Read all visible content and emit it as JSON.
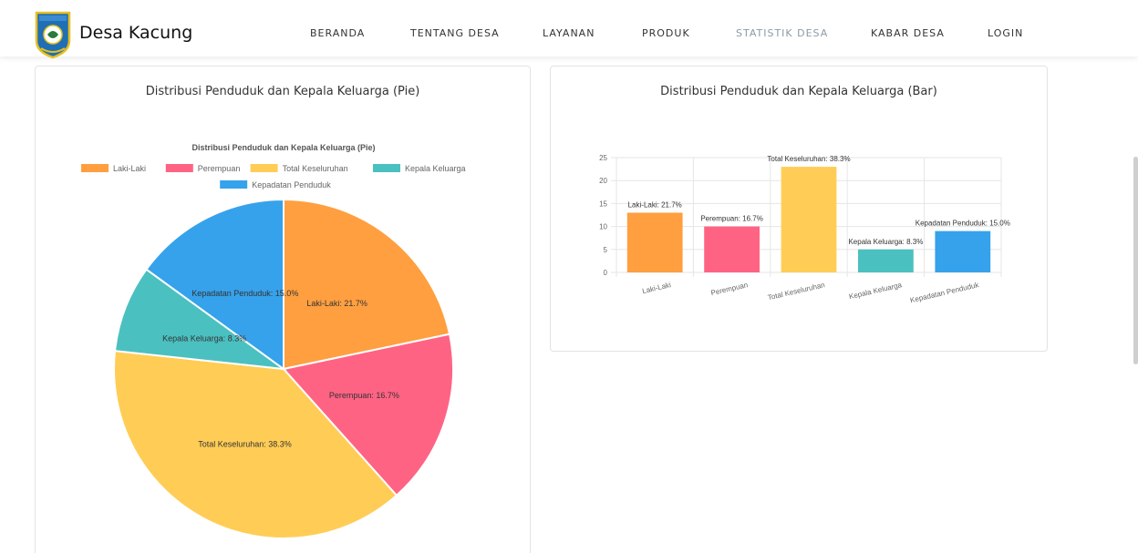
{
  "nav": {
    "brand": "Desa Kacung",
    "items": [
      {
        "label": "BERANDA"
      },
      {
        "label": "TENTANG DESA"
      },
      {
        "label": "LAYANAN"
      },
      {
        "label": "PRODUK"
      },
      {
        "label": "STATISTIK DESA"
      },
      {
        "label": "KABAR DESA"
      },
      {
        "label": "LOGIN"
      }
    ],
    "active_index": 4
  },
  "pie_card": {
    "heading": "Distribusi Penduduk dan Kepala Keluarga (Pie)"
  },
  "bar_card": {
    "heading": "Distribusi Penduduk dan Kepala Keluarga (Bar)"
  },
  "colors": {
    "laki": "#FF9F40",
    "perempuan": "#FF6384",
    "total": "#FFCD56",
    "kk": "#4BC0C0",
    "kepadatan": "#36A2EB",
    "active_nav": "#8c9aa6"
  },
  "chart_data": [
    {
      "type": "pie",
      "title": "Distribusi Penduduk dan Kepala Keluarga (Pie)",
      "categories": [
        "Laki-Laki",
        "Perempuan",
        "Total Keseluruhan",
        "Kepala Keluarga",
        "Kepadatan Penduduk"
      ],
      "values": [
        21.7,
        16.7,
        38.3,
        8.3,
        15.0
      ],
      "labels": [
        "Laki-Laki: 21.7%",
        "Perempuan: 16.7%",
        "Total Keseluruhan: 38.3%",
        "Kepala Keluarga: 8.3%",
        "Kepadatan Penduduk: 15.0%"
      ],
      "colors": [
        "#FF9F40",
        "#FF6384",
        "#FFCD56",
        "#4BC0C0",
        "#36A2EB"
      ],
      "legend": "top"
    },
    {
      "type": "bar",
      "categories": [
        "Laki-Laki",
        "Perempuan",
        "Total Keseluruhan",
        "Kepala Keluarga",
        "Kepadatan Penduduk"
      ],
      "values": [
        13,
        10,
        23,
        5,
        9
      ],
      "labels": [
        "Laki-Laki: 21.7%",
        "Perempuan: 16.7%",
        "Total Keseluruhan: 38.3%",
        "Kepala Keluarga: 8.3%",
        "Kepadatan Penduduk: 15.0%"
      ],
      "colors": [
        "#FF9F40",
        "#FF6384",
        "#FFCD56",
        "#4BC0C0",
        "#36A2EB"
      ],
      "ylim": [
        0,
        25
      ],
      "yticks": [
        "0",
        "5",
        "10",
        "15",
        "20",
        "25"
      ],
      "grid": true
    }
  ]
}
